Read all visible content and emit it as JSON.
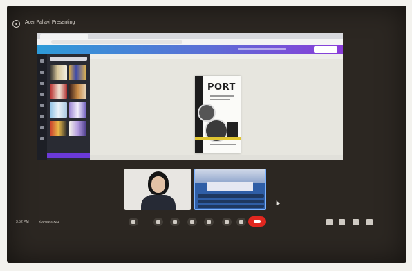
{
  "meeting": {
    "title": "Acer Pallavi Presenting",
    "time": "3:52 PM",
    "code": "xkv-qwrs-xzq"
  },
  "shared_screen": {
    "poster_title": "PORT"
  },
  "colors": {
    "end_call": "#e0271f",
    "app_bar_start": "#2d9bd8",
    "app_bar_end": "#8a3cd9",
    "active_tile_border": "#7bb2ff"
  },
  "controls": {
    "mic": "mic-icon",
    "camera": "camera-icon",
    "captions": "captions-icon",
    "emoji": "emoji-icon",
    "present": "present-icon",
    "raise_hand": "hand-icon",
    "more": "more-icon",
    "end_call": "end-call-icon",
    "info": "info-icon",
    "people": "people-icon",
    "chat": "chat-icon",
    "activities": "activities-icon"
  }
}
